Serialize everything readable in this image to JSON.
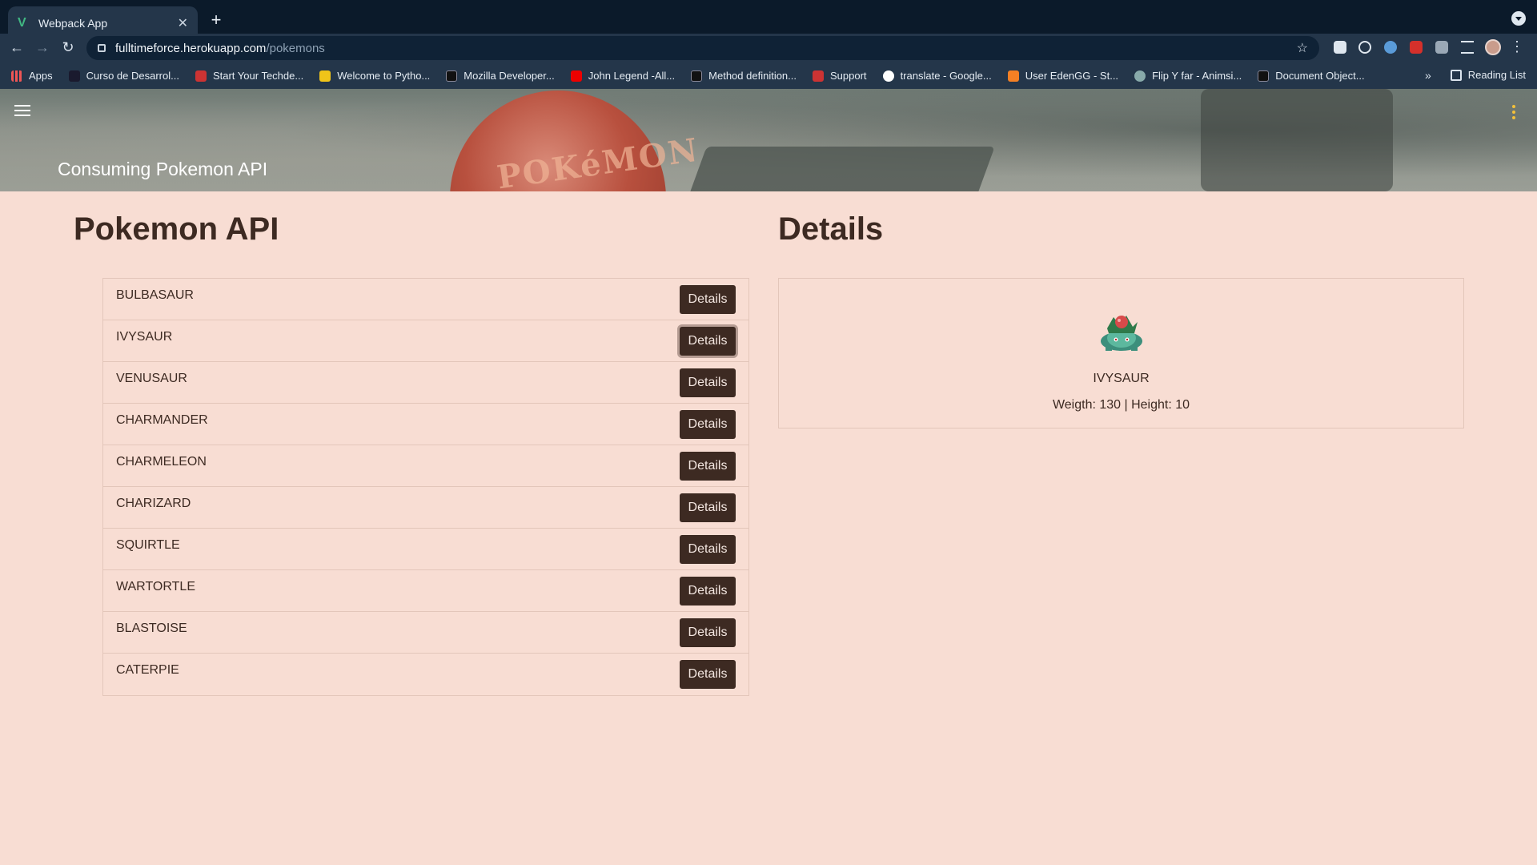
{
  "browser": {
    "tab_title": "Webpack App",
    "url_host": "fulltimeforce.herokuapp.com",
    "url_path": "/pokemons",
    "bookmarks": [
      {
        "label": "Apps",
        "color": "#e55"
      },
      {
        "label": "Curso de Desarrol...",
        "color": "#1a1a2e"
      },
      {
        "label": "Start Your Techde...",
        "color": "#c33"
      },
      {
        "label": "Welcome to Pytho...",
        "color": "#f0c419"
      },
      {
        "label": "Mozilla Developer...",
        "color": "#111"
      },
      {
        "label": "John Legend -All...",
        "color": "#e00"
      },
      {
        "label": "Method definition...",
        "color": "#111"
      },
      {
        "label": "Support",
        "color": "#c33"
      },
      {
        "label": "translate - Google...",
        "color": "#4285f4"
      },
      {
        "label": "User EdenGG - St...",
        "color": "#f48024"
      },
      {
        "label": "Flip Y far - Animsi...",
        "color": "#8aa"
      },
      {
        "label": "Document Object...",
        "color": "#111"
      }
    ],
    "more_label": "»",
    "reading_list": "Reading List"
  },
  "header": {
    "title": "Consuming Pokemon API",
    "image_logo_text": "POKéMON"
  },
  "left": {
    "title": "Pokemon API",
    "button_label": "Details",
    "pokemons": [
      {
        "name": "BULBASAUR"
      },
      {
        "name": "IVYSAUR"
      },
      {
        "name": "VENUSAUR"
      },
      {
        "name": "CHARMANDER"
      },
      {
        "name": "CHARMELEON"
      },
      {
        "name": "CHARIZARD"
      },
      {
        "name": "SQUIRTLE"
      },
      {
        "name": "WARTORTLE"
      },
      {
        "name": "BLASTOISE"
      },
      {
        "name": "CATERPIE"
      }
    ],
    "active_index": 1
  },
  "right": {
    "title": "Details",
    "selected_name": "IVYSAUR",
    "stats": "Weigth: 130 | Height: 10"
  },
  "colors": {
    "page_bg": "#f8ddd3",
    "text": "#3d2a22",
    "button_bg": "#3d2a22",
    "button_text": "#f3e6e0"
  }
}
